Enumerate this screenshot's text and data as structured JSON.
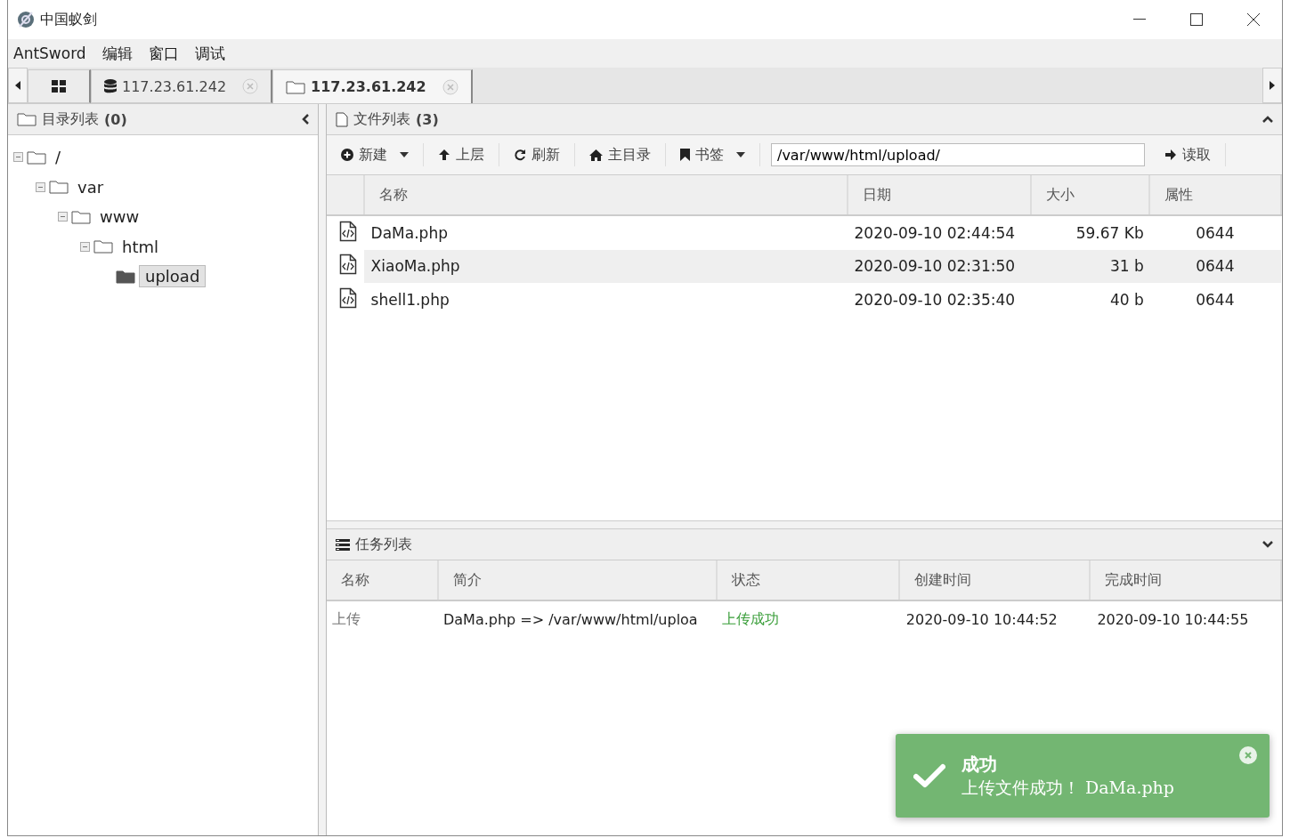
{
  "window": {
    "title": "中国蚁剑"
  },
  "menu": [
    "AntSword",
    "编辑",
    "窗口",
    "调试"
  ],
  "tabs": [
    {
      "kind": "home",
      "selected": false
    },
    {
      "kind": "shell",
      "label": "117.23.61.242",
      "selected": false
    },
    {
      "kind": "files",
      "label": "117.23.61.242",
      "selected": true
    }
  ],
  "dir_panel": {
    "title": "目录列表",
    "count": "(0)",
    "tree": [
      {
        "name": "/",
        "expanded": true,
        "selected": false,
        "children": [
          {
            "name": "var",
            "expanded": true,
            "selected": false,
            "children": [
              {
                "name": "www",
                "expanded": true,
                "selected": false,
                "children": [
                  {
                    "name": "html",
                    "expanded": true,
                    "selected": false,
                    "children": [
                      {
                        "name": "upload",
                        "selected": true
                      }
                    ]
                  }
                ]
              }
            ]
          }
        ]
      }
    ]
  },
  "file_panel": {
    "title": "文件列表",
    "count": "(3)",
    "toolbar": [
      {
        "kind": "new",
        "label": "新建",
        "dropdown": true
      },
      {
        "kind": "up",
        "label": "上层",
        "dropdown": false
      },
      {
        "kind": "refresh",
        "label": "刷新",
        "dropdown": false
      },
      {
        "kind": "home",
        "label": "主目录",
        "dropdown": false
      },
      {
        "kind": "bookmark",
        "label": "书签",
        "dropdown": true
      }
    ],
    "path": "/var/www/html/upload/",
    "read_button": "读取",
    "columns": [
      "名称",
      "日期",
      "大小",
      "属性"
    ],
    "rows": [
      {
        "name": "DaMa.php",
        "date": "2020-09-10 02:44:54",
        "size": "59.67 Kb",
        "mode": "0644",
        "selected": false
      },
      {
        "name": "XiaoMa.php",
        "date": "2020-09-10 02:31:50",
        "size": "31 b",
        "mode": "0644",
        "selected": true
      },
      {
        "name": "shell1.php",
        "date": "2020-09-10 02:35:40",
        "size": "40 b",
        "mode": "0644",
        "selected": false
      }
    ]
  },
  "task_panel": {
    "title": "任务列表",
    "columns": [
      "名称",
      "简介",
      "状态",
      "创建时间",
      "完成时间"
    ],
    "rows": [
      {
        "name": "上传",
        "info": "DaMa.php => /var/www/html/uploa",
        "status": "上传成功",
        "created": "2020-09-10 10:44:52",
        "finished": "2020-09-10 10:44:55"
      }
    ]
  },
  "toast": {
    "title": "成功",
    "message": "上传文件成功！ DaMa.php"
  }
}
